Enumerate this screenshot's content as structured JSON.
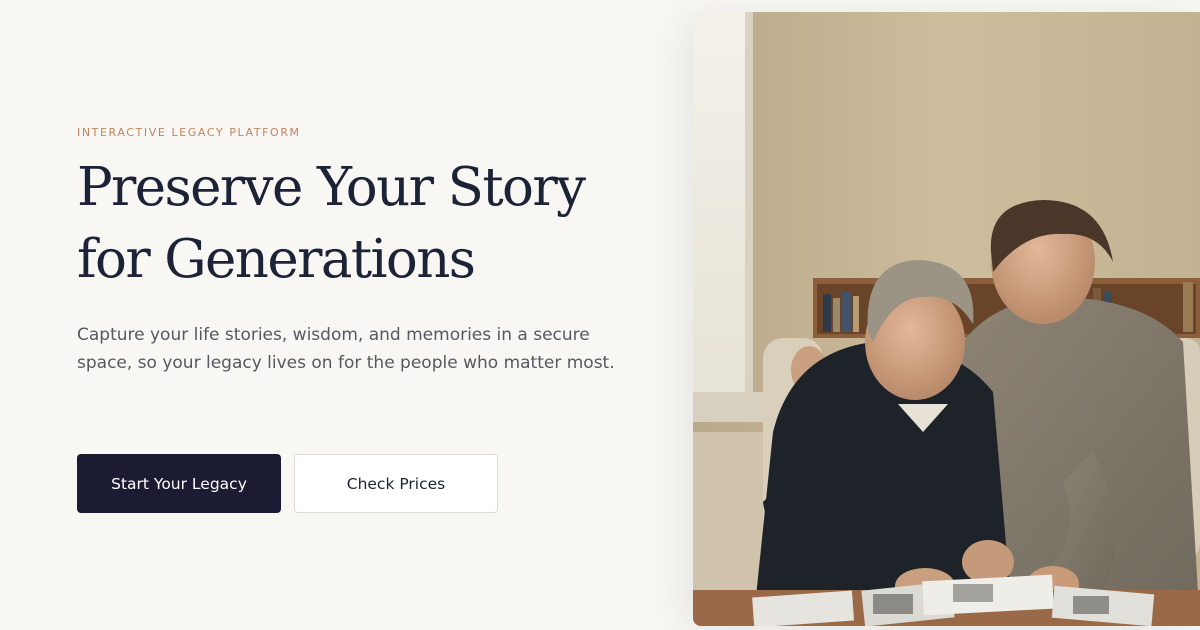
{
  "hero": {
    "eyebrow": "INTERACTIVE LEGACY PLATFORM",
    "headline": "Preserve Your Story for Generations",
    "subcopy": "Capture your life stories, wisdom, and memories in a secure space, so your legacy lives on for the people who matter most."
  },
  "buttons": {
    "primary_label": "Start Your Legacy",
    "secondary_label": "Check Prices"
  },
  "colors": {
    "background": "#f8f7f4",
    "eyebrow": "#c0855c",
    "headline": "#1d2336",
    "primary_button": "#1b1c33"
  }
}
